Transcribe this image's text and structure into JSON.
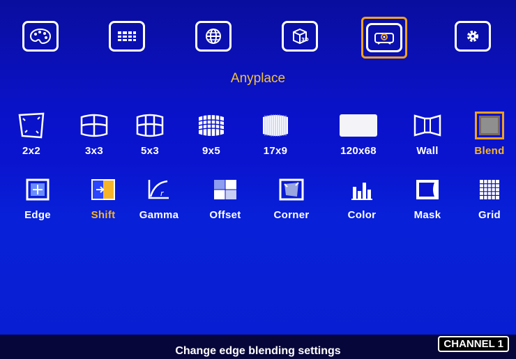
{
  "top_menu": [
    {
      "name": "palette-icon"
    },
    {
      "name": "layout-icon"
    },
    {
      "name": "globe-icon"
    },
    {
      "name": "3d-cube-icon"
    },
    {
      "name": "projector-icon",
      "selected": true
    },
    {
      "name": "gear-icon"
    }
  ],
  "section_title": "Anyplace",
  "row1": [
    {
      "label": "2x2",
      "icon": "warp-2x2-icon"
    },
    {
      "label": "3x3",
      "icon": "grid-3x3-icon"
    },
    {
      "label": "5x3",
      "icon": "grid-5x3-icon"
    },
    {
      "label": "9x5",
      "icon": "grid-9x5-icon"
    },
    {
      "label": "17x9",
      "icon": "grid-17x9-icon"
    },
    {
      "label": "120x68",
      "icon": "grid-120x68-icon"
    },
    {
      "label": "Wall",
      "icon": "wall-icon"
    },
    {
      "label": "Blend",
      "icon": "blend-icon",
      "selected": true
    }
  ],
  "row2": [
    {
      "label": "Edge",
      "icon": "edge-icon"
    },
    {
      "label": "Shift",
      "icon": "shift-icon",
      "selected": true
    },
    {
      "label": "Gamma",
      "icon": "gamma-icon"
    },
    {
      "label": "Offset",
      "icon": "offset-icon"
    },
    {
      "label": "Corner",
      "icon": "corner-icon"
    },
    {
      "label": "Color",
      "icon": "color-bars-icon"
    },
    {
      "label": "Mask",
      "icon": "mask-icon"
    },
    {
      "label": "Grid",
      "icon": "grid-icon"
    }
  ],
  "status": {
    "help_text": "Change edge blending settings",
    "channel": "CHANNEL 1"
  },
  "colors": {
    "background": "#0a14cf",
    "highlight": "#f0a020",
    "title": "#f3c23a"
  }
}
